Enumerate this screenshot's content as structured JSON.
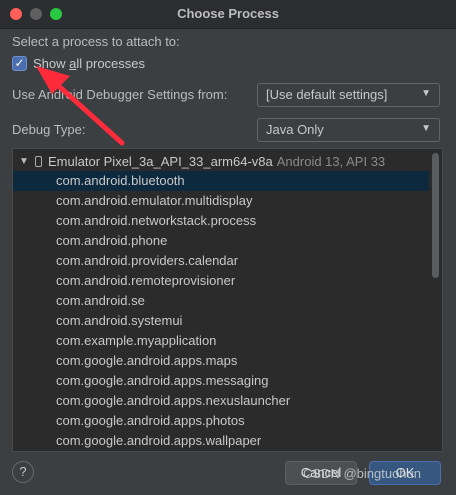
{
  "window": {
    "title": "Choose Process"
  },
  "prompt": "Select a process to attach to:",
  "show_all": {
    "label_pre": "Show ",
    "label_u": "a",
    "label_post": "ll processes",
    "checked": true
  },
  "settings_row": {
    "label": "Use Android Debugger Settings from:",
    "value": "[Use default settings]"
  },
  "debug_type_row": {
    "label": "Debug Type:",
    "value": "Java Only"
  },
  "device": {
    "name": "Emulator Pixel_3a_API_33_arm64-v8a",
    "api": "Android 13, API 33"
  },
  "processes": [
    "com.android.bluetooth",
    "com.android.emulator.multidisplay",
    "com.android.networkstack.process",
    "com.android.phone",
    "com.android.providers.calendar",
    "com.android.remoteprovisioner",
    "com.android.se",
    "com.android.systemui",
    "com.example.myapplication",
    "com.google.android.apps.maps",
    "com.google.android.apps.messaging",
    "com.google.android.apps.nexuslauncher",
    "com.google.android.apps.photos",
    "com.google.android.apps.wallpaper"
  ],
  "selected_index": 0,
  "buttons": {
    "help": "?",
    "cancel": "Cancel",
    "ok": "OK"
  },
  "watermark": "CSDN @bingtuohun",
  "colors": {
    "annotation_arrow": "#ff2b3a",
    "selection": "#0d293e",
    "accent": "#4b6eaf"
  }
}
